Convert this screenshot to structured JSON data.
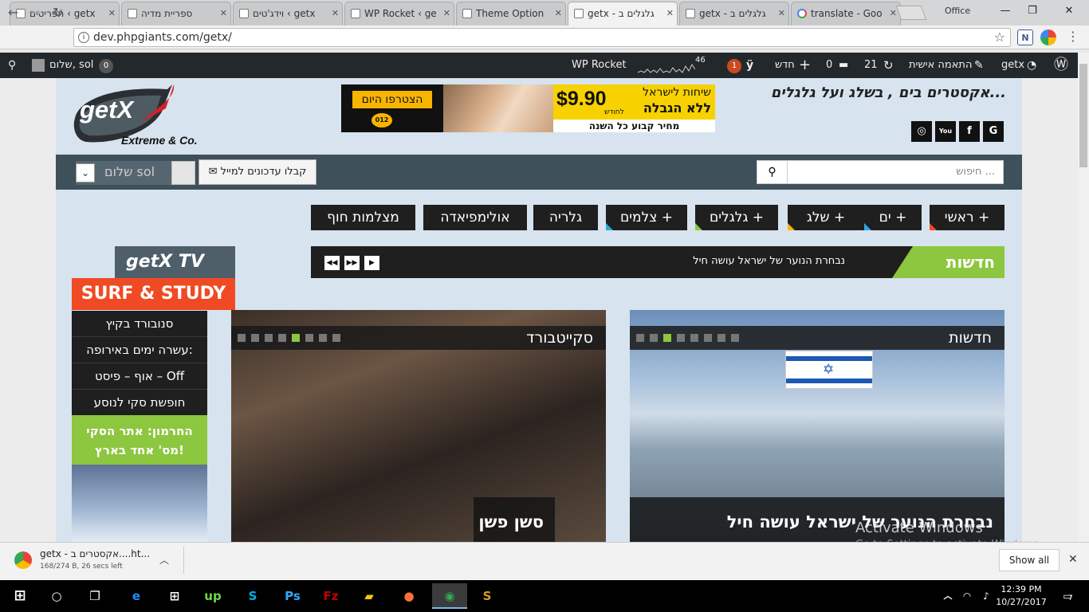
{
  "browser": {
    "tabs": [
      {
        "title": "תפריטים ‹ getx"
      },
      {
        "title": "ספריית מדיה"
      },
      {
        "title": "וידג'טים ‹ getx"
      },
      {
        "title": "WP Rocket ‹ ge"
      },
      {
        "title": "Theme Option"
      },
      {
        "title": "getx - גלגלים ב"
      },
      {
        "title": "getx - גלגלים ב"
      },
      {
        "title": "translate - Goo"
      }
    ],
    "profile_label": "Office",
    "url": "dev.phpgiants.com/getx/",
    "ext_n": "N"
  },
  "wpbar": {
    "site_name": "getx",
    "customize": "התאמה אישית",
    "updates_count": "21",
    "comments_count": "0",
    "new_label": "חדש",
    "yoast_badge": "1",
    "stats_count": "46",
    "rocket": "WP Rocket",
    "notif_count": "0",
    "greeting": "שלום, sol"
  },
  "header": {
    "logo_text": "getX",
    "logo_sub": "Extreme & Co.",
    "tagline": "אקסטרים בים , בשלג ועל גלגלים...",
    "ad": {
      "join": "הצטרפו היום",
      "price": "$9.90",
      "per_month": "לחודש",
      "line1": "שיחות לישראל",
      "line2": "ללא הגבלה",
      "line3": "מחיר קבוע כל השנה",
      "brand": "012"
    },
    "social": [
      "G",
      "f",
      "You",
      "◎"
    ]
  },
  "topbar": {
    "search_placeholder": "חיפוש ...",
    "subscribe": "קבלו עדכונים למייל",
    "user_greeting": "שלום sol"
  },
  "menu": [
    {
      "label": "ראשי +",
      "accent": "#ef4a23"
    },
    {
      "label": "ים +",
      "accent": "#29abe2"
    },
    {
      "label": "שלג +",
      "accent": "#f7b500"
    },
    {
      "label": "גלגלים +",
      "accent": "#8dc63f"
    },
    {
      "label": "צלמים +",
      "accent": "#29abe2"
    },
    {
      "label": "גלריה",
      "accent": ""
    },
    {
      "label": "אולימפיאדה",
      "accent": ""
    },
    {
      "label": "מצלמות חוף",
      "accent": ""
    }
  ],
  "ticker": {
    "label": "חדשות",
    "text": "נבחרת הנוער של ישראל עושה חיל"
  },
  "sidebar": {
    "tv_title": "getX TV",
    "surf_title": "SURF & STUDY",
    "items": [
      "סנובורד בקיץ",
      "עשרה ימים באירופה:",
      "אוף – פיסט – Off",
      "חופשת סקי לנוסע"
    ],
    "green_line1": "החרמון: אתר הסקי",
    "green_line2": "מס' אחד בארץ!"
  },
  "features": [
    {
      "category": "חדשות",
      "title": "נבחרת הנוער של ישראל עושה חיל",
      "active_dot": 2
    },
    {
      "category": "סקייטבורד",
      "title": "סשן פשן",
      "active_dot": 4
    }
  ],
  "download": {
    "filename": "getx - אקסטרים ב....ht...",
    "status": "168/274 B, 26 secs left",
    "show_all": "Show all"
  },
  "watermark": {
    "line1": "Activate Windows",
    "line2": "Go to Settings to activate Windows."
  },
  "taskbar": {
    "time": "12:39 PM",
    "date": "10/27/2017",
    "notif": "7"
  },
  "colors": {
    "accent_green": "#8dc63f",
    "accent_orange": "#ef4a23",
    "nav_dark": "#3e505a",
    "wp_bar": "#23282d"
  }
}
